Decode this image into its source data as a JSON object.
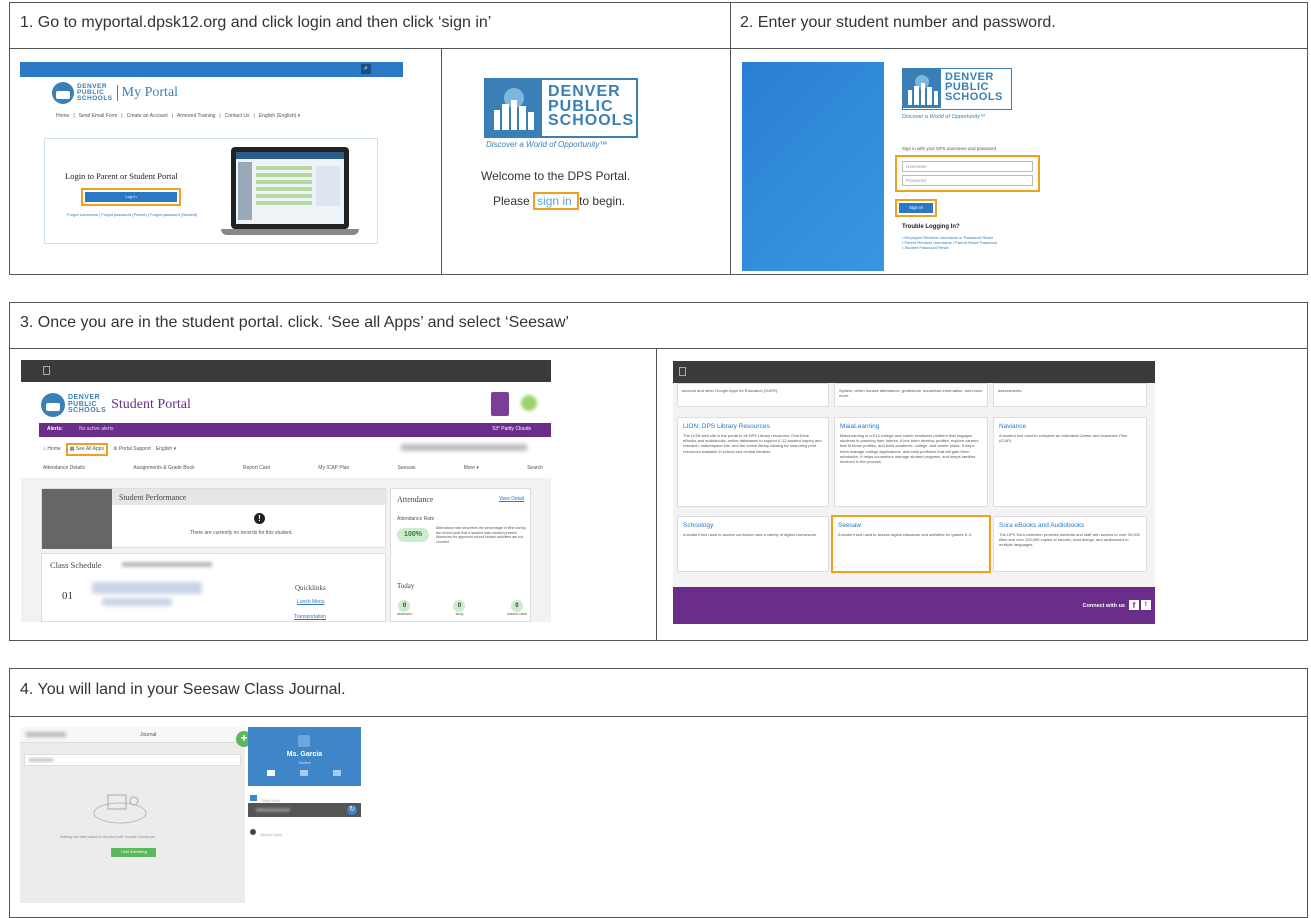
{
  "step1": {
    "title": "1. Go to myportal.dpsk12.org and click login and then click ‘sign in’",
    "portal": {
      "brand_line1": "DENVER",
      "brand_line2": "PUBLIC",
      "brand_line3": "SCHOOLS",
      "portal_name": "My Portal",
      "nav": [
        "Home",
        "Send Email Form",
        "Create an Account",
        "Armored Training",
        "Contact Us",
        "English (English) ▾"
      ],
      "login_heading": "Login to Parent or Student Portal",
      "login_button": "Log In",
      "forgot_links": "Forgot Username | Forgot password (Parent) | Forgot password (Student)"
    },
    "welcome": {
      "brand_line1": "DENVER",
      "brand_line2": "PUBLIC",
      "brand_line3": "SCHOOLS",
      "tagline": "Discover a World of Opportunity™",
      "welcome_text": "Welcome to the DPS Portal.",
      "please": "Please",
      "sign_in_link": "sign in",
      "to_begin": "to begin."
    }
  },
  "step2": {
    "title": "2. Enter your student number and password.",
    "brand_line1": "DENVER",
    "brand_line2": "PUBLIC",
    "brand_line3": "SCHOOLS",
    "tagline": "Discover a World of Opportunity™",
    "instruction": "Sign in with your DPS username and password",
    "username_placeholder": "Username",
    "password_placeholder": "Password",
    "sign_in_button": "Sign In",
    "trouble_heading": "Trouble Logging In?",
    "trouble_links": [
      "Employee Retrieve Username or Password Reset",
      "Parent Retrieve Username / Parent Reset Password",
      "Student Password Reset"
    ]
  },
  "step3": {
    "title": "3. Once you are in the student portal. click. ‘See all Apps’ and select ‘Seesaw’",
    "student_portal": {
      "brand_line1": "DENVER",
      "brand_line2": "PUBLIC",
      "brand_line3": "SCHOOLS",
      "portal_name": "Student Portal",
      "alerts_label": "Alerts:",
      "alerts_text": "No active alerts",
      "weather": "53° Partly Clouds",
      "home": "Home",
      "see_all_apps": "See All Apps",
      "portal_support": "Portal Support",
      "language": "English ▾",
      "tabs": [
        "Attendance Details",
        "Assignments & Grade Book",
        "Report Card",
        "My ICAP Plan",
        "Seesaw",
        "More ▾",
        "Search"
      ],
      "performance_title": "Student Performance",
      "no_records": "There are currently no records for this student.",
      "schedule_title": "Class Schedule",
      "schedule_period": "01",
      "quicklinks_title": "Quicklinks",
      "quicklinks": [
        "Lunch Menu",
        "Transportation"
      ],
      "attendance_title": "Attendance",
      "view_detail": "View Detail",
      "attendance_rate_label": "Attendance Rate",
      "attendance_rate": "100%",
      "attendance_note": "Attendance rate describes the percentage of time during the school year that a student was marked present. Absences for approved school related activities are not counted.",
      "today_title": "Today",
      "today_counts": [
        {
          "value": "0",
          "label": "absences"
        },
        {
          "value": "0",
          "label": "tardy"
        },
        {
          "value": "0",
          "label": "missed class"
        }
      ]
    },
    "apps": {
      "top_texts": [
        "account and other Google Apps for Education (GAFE).",
        "System, which houses attendance, gradebook, household information, and much more.",
        "assessments."
      ],
      "cards": [
        {
          "title": "LION: DPS Library Resources",
          "desc": "The LION web site is the portal to all DPS Library resources: OverDrive eBooks and audiobooks, online databases to support K-12 student inquiry and research, makerspace kits, and the online library catalog for searching print resources available in school and central libraries."
        },
        {
          "title": "MaiaLearning",
          "desc": "MaiaLearning is a K12 college and career readiness platform that engages students in planning their futures. It lets them develop profiles, explore careers that fit those profiles, and build academic, college, and career plans. It helps them manage college applications, and build portfolios that will gain them admission. It helps counselors manage student progress, and keeps families involved in the process."
        },
        {
          "title": "Naviance",
          "desc": "A student tool used to complete an Individual Career and Academic Plan (ICAP)."
        },
        {
          "title": "Schoology",
          "desc": "A student tool used to access curriculum and a variety of digital coursework."
        },
        {
          "title": "Seesaw",
          "desc": "A student tool used to access digital classwork and activities for grades K-3."
        },
        {
          "title": "Sora eBooks and Audiobooks",
          "desc": "The DPS Sora collection provides students and staff with access to over 30,000 titles and over 100,000 copies of ebooks, read alongs, and audiobooks in multiple languages."
        }
      ],
      "connect": "Connect with us"
    }
  },
  "step4": {
    "title": "4. You will land in your Seesaw Class Journal.",
    "journal_title": "Journal",
    "empty_message": "Nothing has been added to Secosa Kraft Yourself Journal yet.",
    "add_button": "+ Add Something",
    "teacher_name": "Ms. Garcia",
    "teacher_role": "Student",
    "class_item": "Class name",
    "student_item": "Student name"
  },
  "colors": {
    "border": "#555555",
    "highlight": "#f0a020",
    "dps_blue": "#3a7fb5",
    "portal_purple": "#6a2e8a",
    "seesaw_blue": "#3f86c9",
    "seesaw_green": "#5cb85c"
  }
}
